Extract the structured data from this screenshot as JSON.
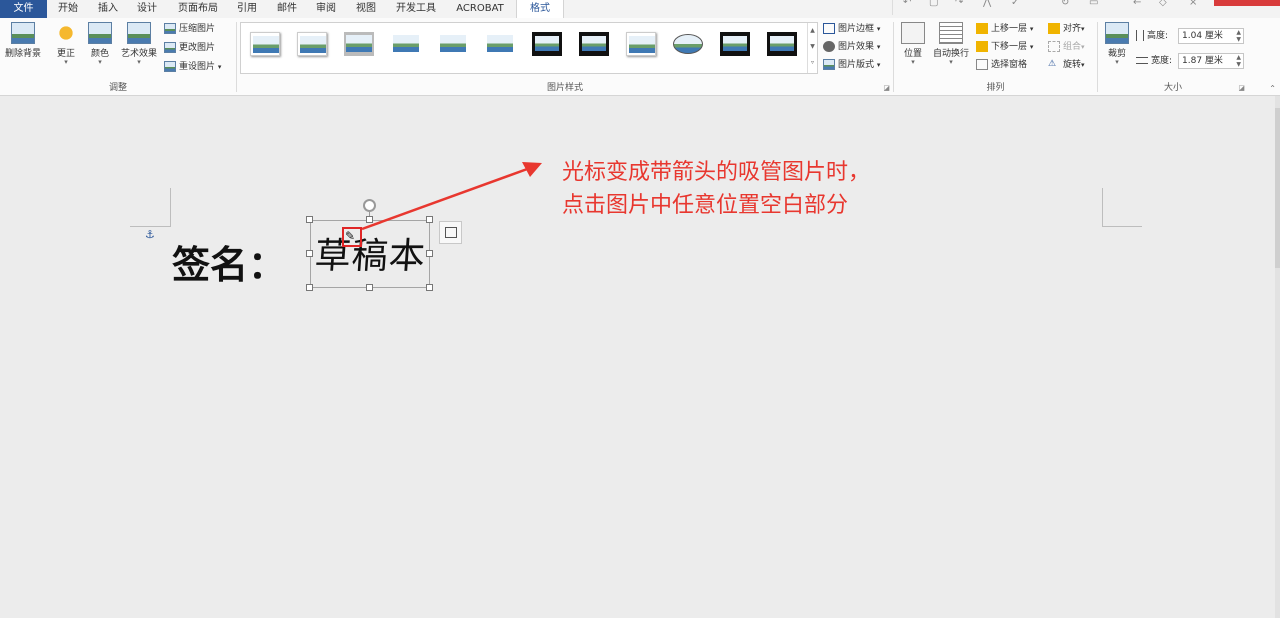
{
  "tabs": [
    {
      "label": "文件"
    },
    {
      "label": "开始"
    },
    {
      "label": "插入"
    },
    {
      "label": "设计"
    },
    {
      "label": "页面布局"
    },
    {
      "label": "引用"
    },
    {
      "label": "邮件"
    },
    {
      "label": "审阅"
    },
    {
      "label": "视图"
    },
    {
      "label": "开发工具"
    },
    {
      "label": "ACROBAT"
    },
    {
      "label": "格式"
    }
  ],
  "active_tab": "格式",
  "ribbon": {
    "adjust": {
      "label": "调整",
      "remove_bg": "删除背景",
      "corrections": "更正",
      "color": "颜色",
      "artistic": "艺术效果",
      "compress": "压缩图片",
      "change": "更改图片",
      "reset": "重设图片"
    },
    "styles": {
      "label": "图片样式",
      "border": "图片边框",
      "effects": "图片效果",
      "layout": "图片版式"
    },
    "arrange": {
      "label": "排列",
      "position": "位置",
      "wrap": "自动换行",
      "bring_forward": "上移一层",
      "send_backward": "下移一层",
      "selection_pane": "选择窗格",
      "align": "对齐",
      "group": "组合",
      "rotate": "旋转"
    },
    "size": {
      "label": "大小",
      "crop": "裁剪",
      "height_label": "高度:",
      "height_value": "1.04 厘米",
      "width_label": "宽度:",
      "width_value": "1.87 厘米"
    }
  },
  "document": {
    "signature_label": "签名：",
    "picture_text": "草稿本"
  },
  "annotation": {
    "line1": "光标变成带箭头的吸管图片时，",
    "line2": "点击图片中任意位置空白部分",
    "color": "#e8372f"
  },
  "colors": {
    "accent": "#2b579a",
    "highlight_box": "#e02626"
  }
}
